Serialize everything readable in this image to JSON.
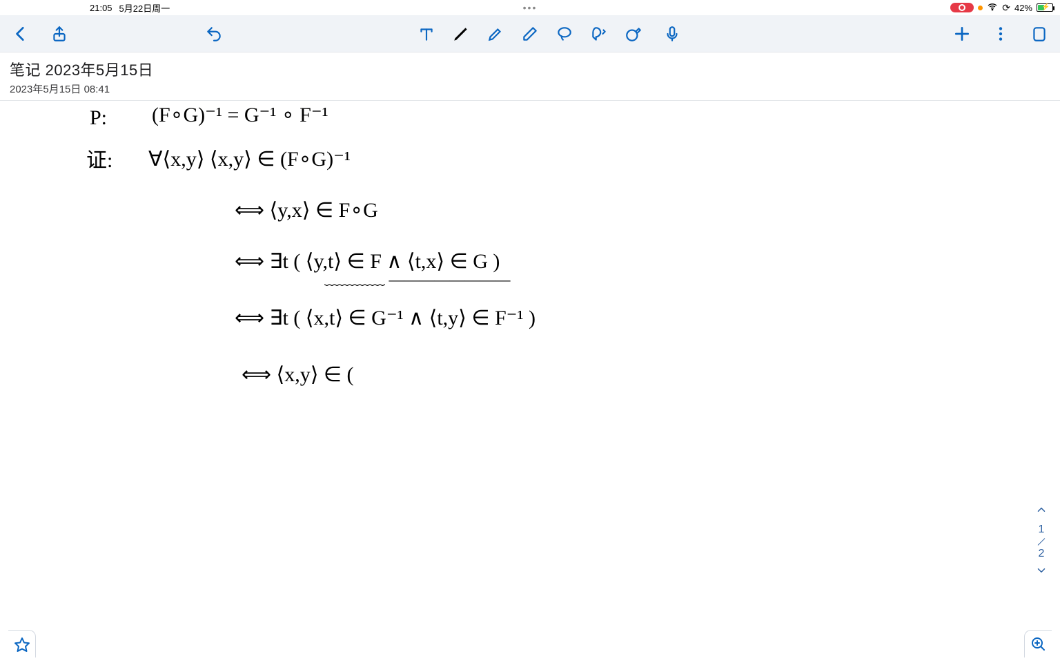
{
  "status": {
    "time": "21:05",
    "date": "5月22日周一",
    "battery_pct": "42%",
    "app_dots": "•••"
  },
  "note": {
    "title": "笔记 2023年5月15日",
    "date": "2023年5月15日 08:41"
  },
  "hw": {
    "l1a": "P:",
    "l1b": "(F∘G)⁻¹  =   G⁻¹ ∘ F⁻¹",
    "l2a": "证:",
    "l2b": "∀⟨x,y⟩      ⟨x,y⟩ ∈ (F∘G)⁻¹",
    "l3": "⟺   ⟨y,x⟩ ∈  F∘G",
    "l4": "⟺   ∃t ( ⟨y,t⟩ ∈ F ∧ ⟨t,x⟩ ∈ G )",
    "l4u": "     ﹏﹏﹏﹏      ————————",
    "l5": "⟺   ∃t ( ⟨x,t⟩ ∈ G⁻¹ ∧ ⟨t,y⟩ ∈ F⁻¹ )",
    "l6": "⟺    ⟨x,y⟩  ∈  ("
  },
  "pager": {
    "cur": "1",
    "total": "2"
  }
}
